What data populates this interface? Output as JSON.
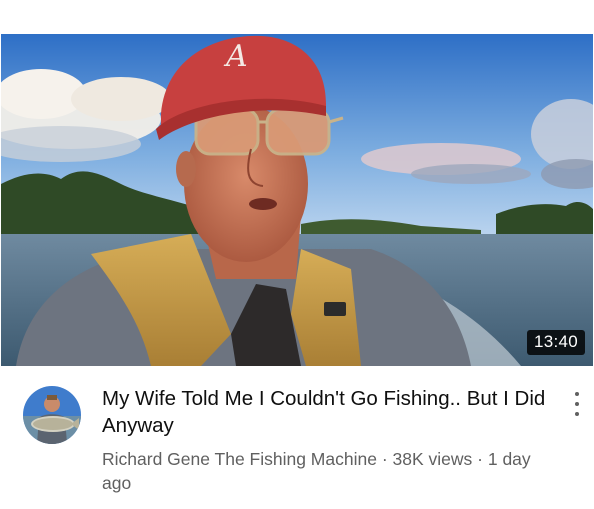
{
  "video": {
    "duration": "13:40",
    "title": "My Wife Told Me I Couldn't Go Fishing.. But I Did Anyway",
    "channel": "Richard Gene The Fishing Machine",
    "views": "38K views",
    "age": "1 day ago",
    "separator": " · ",
    "cap_logo_letter": "A"
  },
  "icons": {
    "more": "more-vert-icon"
  },
  "colors": {
    "cap": "#c7403f",
    "life_vest": "#c9a04a",
    "sky": "#3d7fd0",
    "water": "#4e6f86",
    "text_secondary": "#606060"
  }
}
